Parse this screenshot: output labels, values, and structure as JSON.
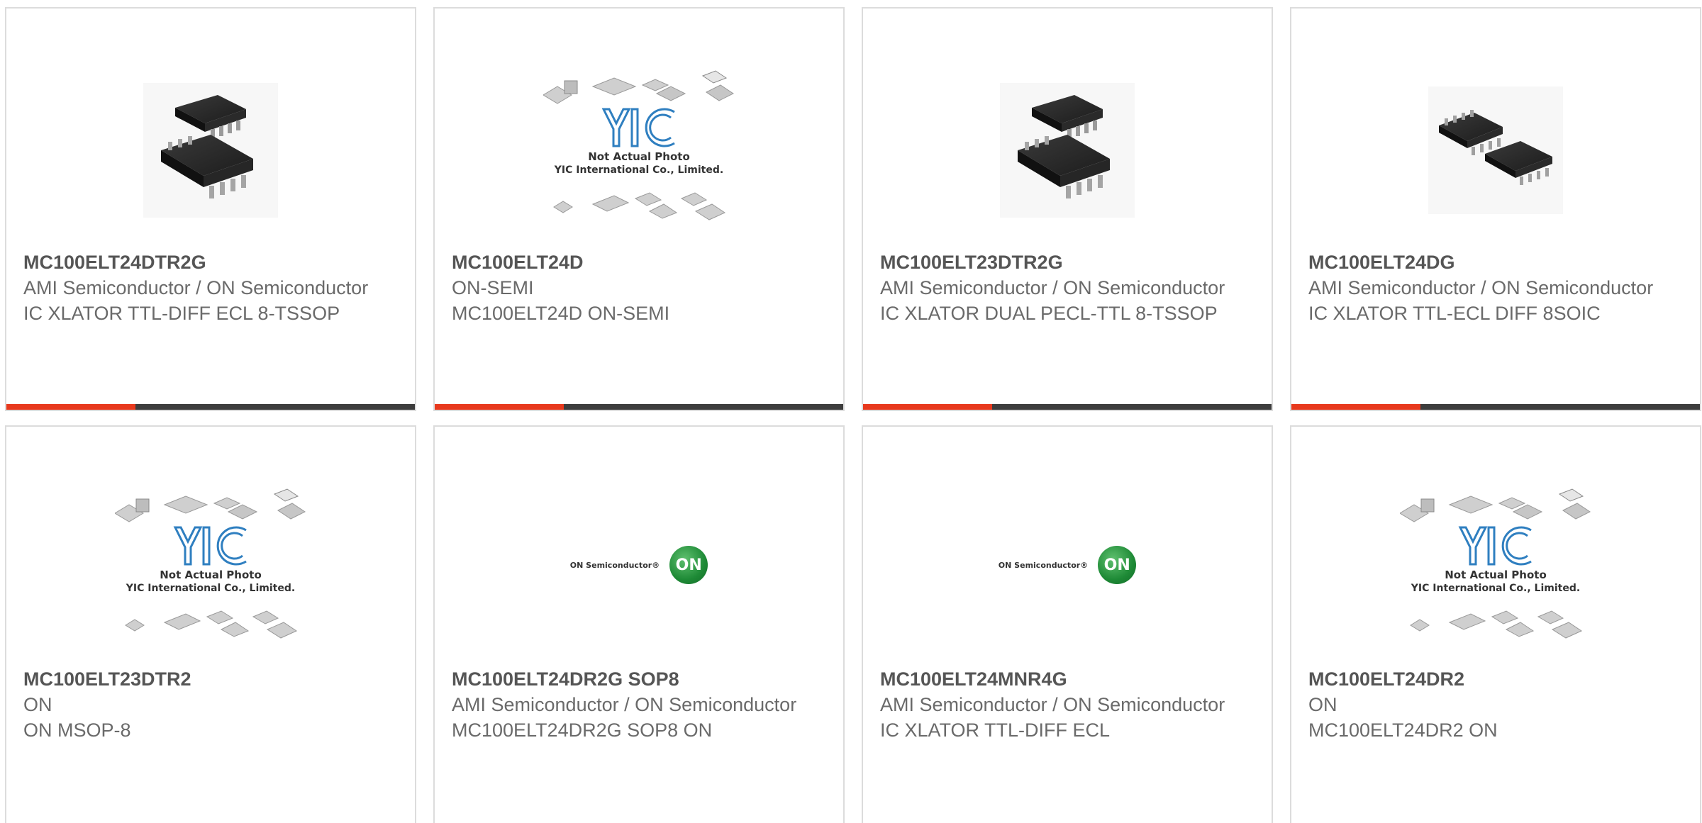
{
  "colors": {
    "accent_red": "#e8391d",
    "accent_dark": "#3d3d3d",
    "card_border": "#dcdcdc",
    "text": "#6a6a6a"
  },
  "products": [
    {
      "part_number": "MC100ELT24DTR2G",
      "manufacturer": "AMI Semiconductor / ON Semiconductor",
      "description": "IC XLATOR TTL-DIFF ECL 8-TSSOP",
      "image": "ic-package-photo-dual"
    },
    {
      "part_number": "MC100ELT24D",
      "manufacturer": "ON-SEMI",
      "description": "MC100ELT24D ON-SEMI",
      "image": "yic-not-actual-photo",
      "image_caption_1": "Not Actual Photo",
      "image_caption_2": "YIC International Co., Limited."
    },
    {
      "part_number": "MC100ELT23DTR2G",
      "manufacturer": "AMI Semiconductor / ON Semiconductor",
      "description": "IC XLATOR DUAL PECL-TTL 8-TSSOP",
      "image": "ic-package-photo-dual"
    },
    {
      "part_number": "MC100ELT24DG",
      "manufacturer": "AMI Semiconductor / ON Semiconductor",
      "description": "IC XLATOR TTL-ECL DIFF 8SOIC",
      "image": "ic-package-photo-soic"
    },
    {
      "part_number": "MC100ELT23DTR2",
      "manufacturer": "ON",
      "description": "ON MSOP-8",
      "image": "yic-not-actual-photo",
      "image_caption_1": "Not Actual Photo",
      "image_caption_2": "YIC International Co., Limited."
    },
    {
      "part_number": "MC100ELT24DR2G SOP8",
      "manufacturer": "AMI Semiconductor / ON Semiconductor",
      "description": "MC100ELT24DR2G SOP8 ON",
      "image": "on-semiconductor-logo",
      "logo_text": "ON Semiconductor®",
      "logo_mark": "ON"
    },
    {
      "part_number": "MC100ELT24MNR4G",
      "manufacturer": "AMI Semiconductor / ON Semiconductor",
      "description": "IC XLATOR TTL-DIFF ECL",
      "image": "on-semiconductor-logo",
      "logo_text": "ON Semiconductor®",
      "logo_mark": "ON"
    },
    {
      "part_number": "MC100ELT24DR2",
      "manufacturer": "ON",
      "description": "MC100ELT24DR2 ON",
      "image": "yic-not-actual-photo",
      "image_caption_1": "Not Actual Photo",
      "image_caption_2": "YIC International Co., Limited."
    }
  ]
}
